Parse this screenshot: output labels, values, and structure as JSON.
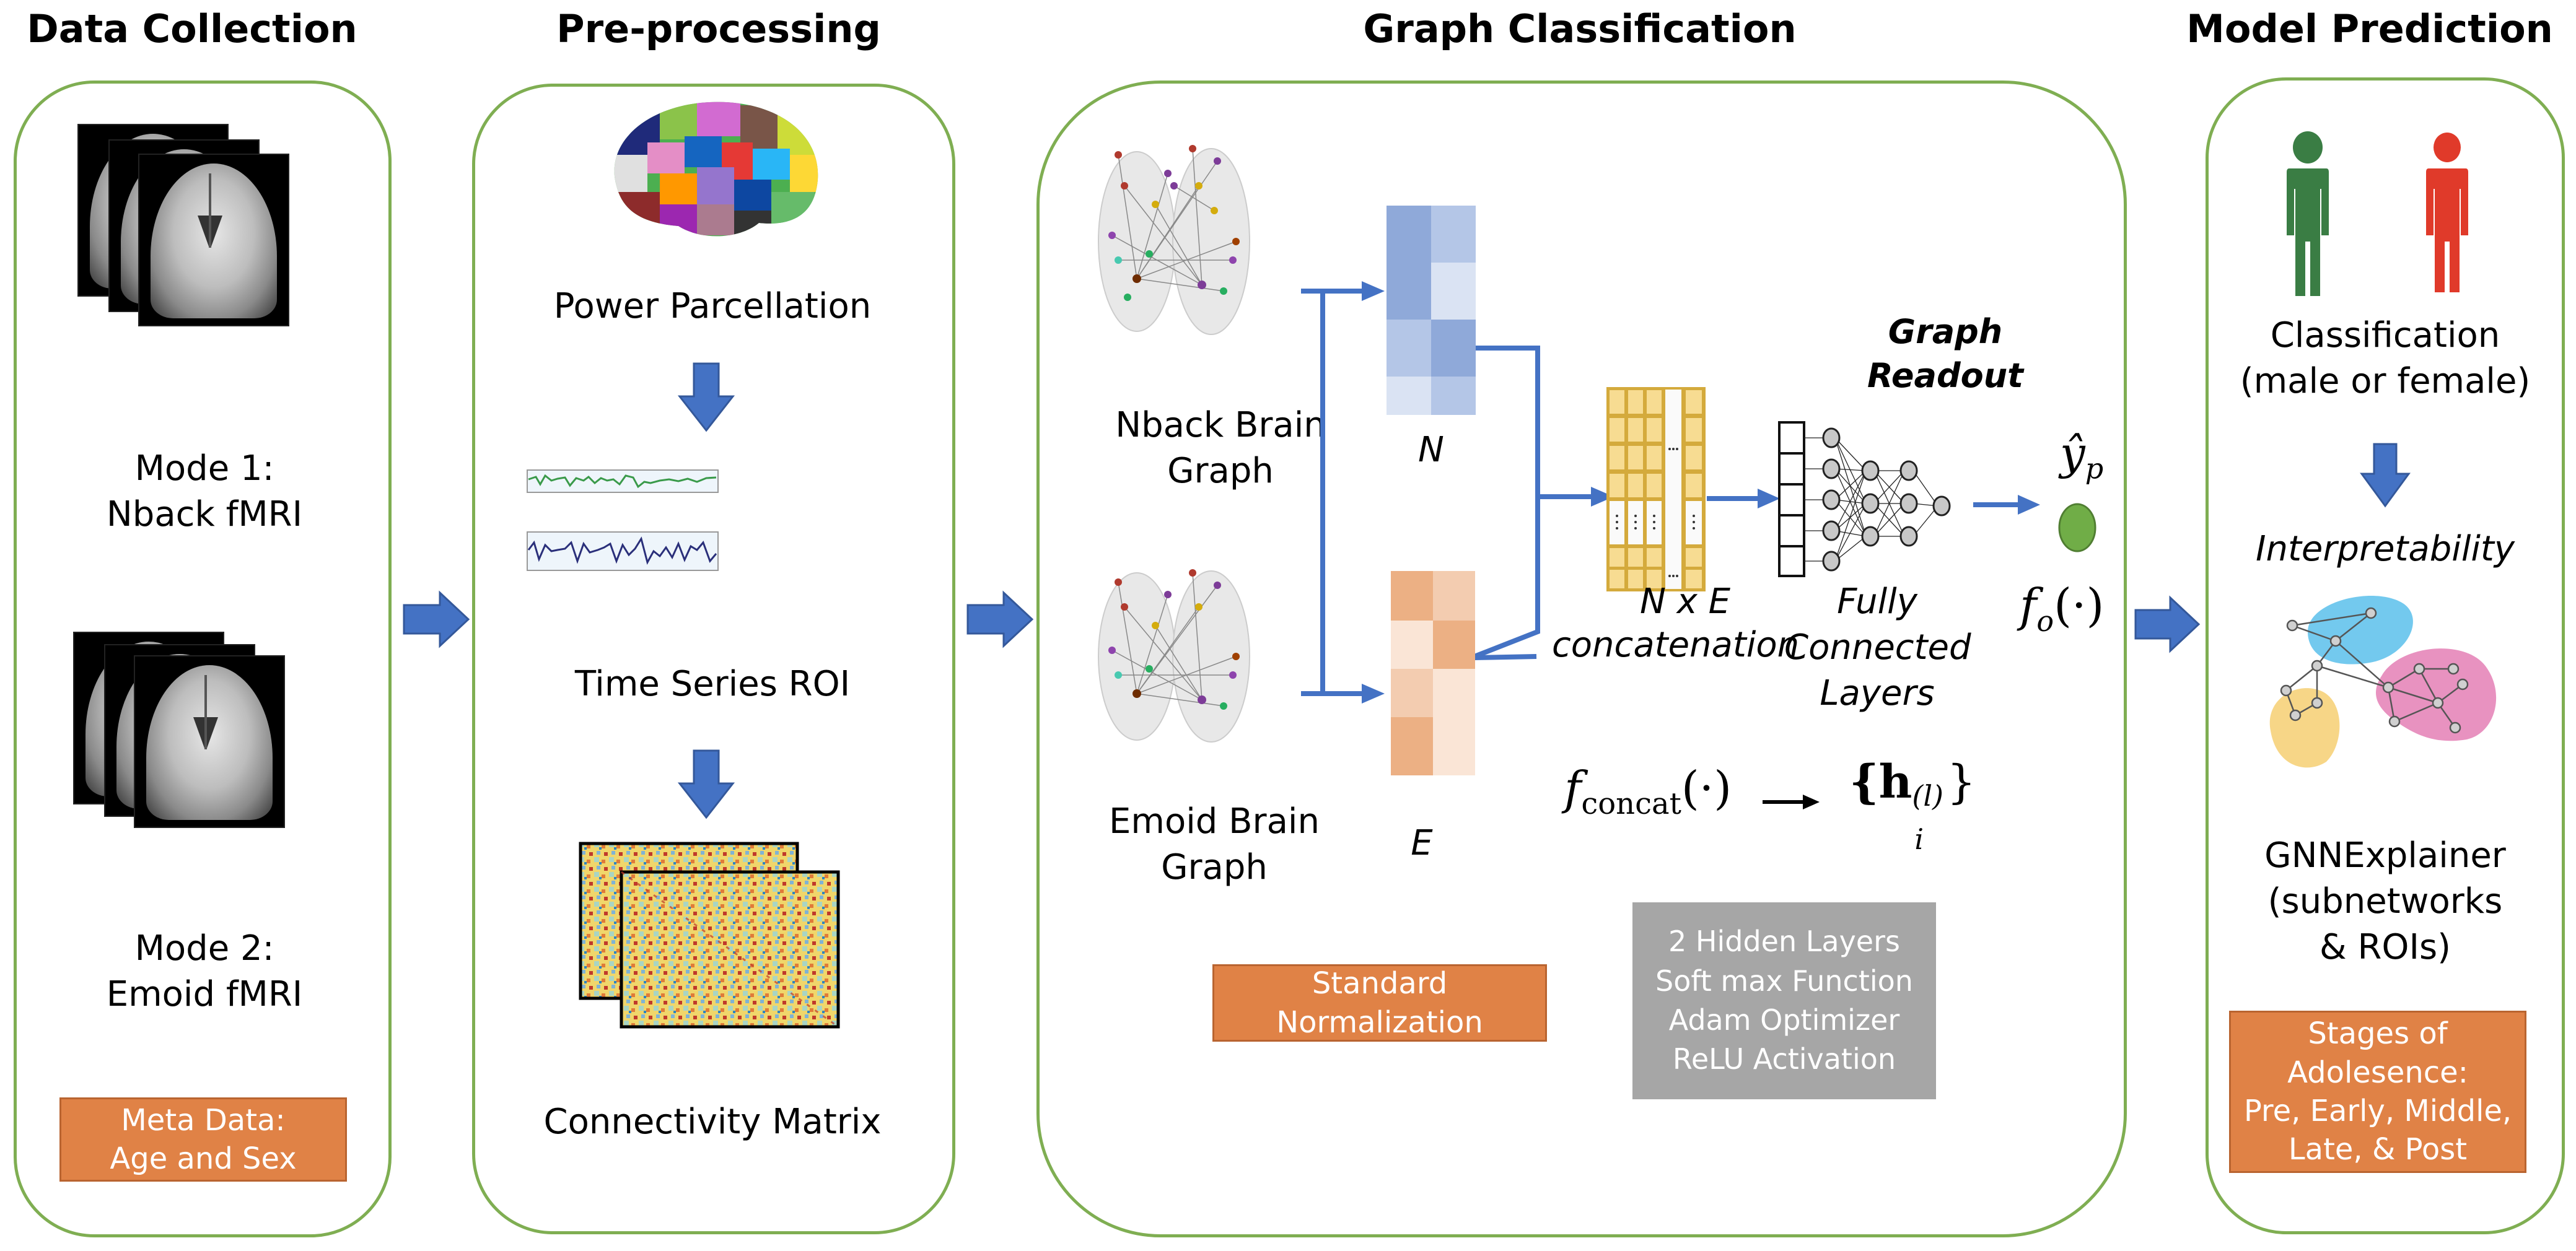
{
  "stages": {
    "data_collection": {
      "title": "Data Collection",
      "mode1_label": "Mode 1:\nNback fMRI",
      "mode2_label": "Mode 2:\nEmoid fMRI",
      "meta_box": "Meta Data:\nAge and Sex"
    },
    "preprocessing": {
      "title": "Pre-processing",
      "parcellation_label": "Power Parcellation",
      "timeseries_label": "Time Series ROI",
      "connectivity_label": "Connectivity Matrix"
    },
    "graph_classification": {
      "title": "Graph Classification",
      "nback_graph_label": "Nback Brain\nGraph",
      "emoid_graph_label": "Emoid Brain\nGraph",
      "n_label": "N",
      "e_label": "E",
      "concat_label_1": "N x E",
      "concat_label_2": "concatenation",
      "fc_label": "Fully\nConnected\nLayers",
      "readout_label": "Graph Readout",
      "f_concat_formula": "f",
      "f_concat_sub": "concat",
      "f_concat_args": "(·)",
      "h_formula": "{h",
      "h_sub": "i",
      "h_sup": "(l)",
      "h_close": "}",
      "y_hat": "ŷ",
      "y_sub": "p",
      "f_o": "f",
      "f_o_sub": "o",
      "f_o_args": "(·)",
      "normalization_box": "Standard\nNormalization",
      "hyperparams_box": "2 Hidden Layers\nSoft max Function\nAdam Optimizer\nReLU Activation"
    },
    "model_prediction": {
      "title": "Model Prediction",
      "classification_label": "Classification\n(male or female)",
      "interpretability_label": "Interpretability",
      "gnnexplainer_label": "GNNExplainer\n(subnetworks\n& ROIs)",
      "stages_box": "Stages of\nAdolesence:\nPre, Early, Middle,\nLate, & Post"
    }
  },
  "colors": {
    "panel_border": "#7fae52",
    "arrow_blue": "#4472c4",
    "orange": "#e08246",
    "gray": "#a6a6a6",
    "male_green": "#3a7d44",
    "female_red": "#e03a2a",
    "output_green": "#70ad47"
  }
}
